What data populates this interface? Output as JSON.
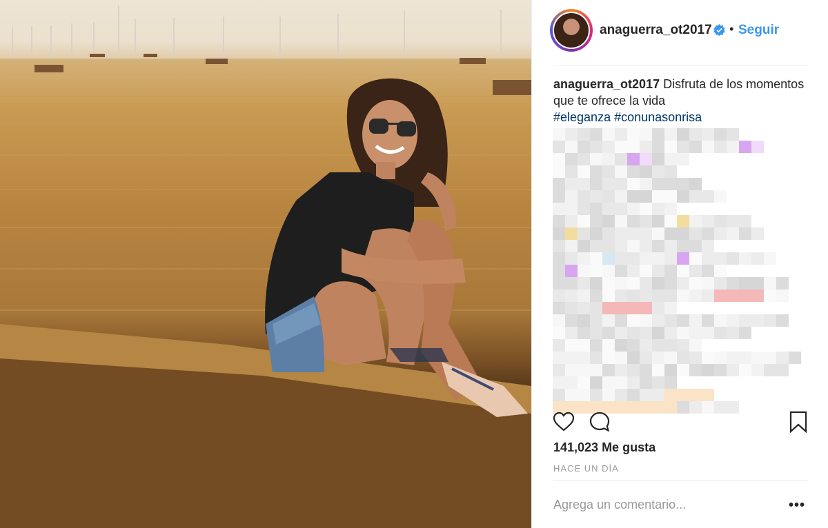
{
  "post": {
    "username": "anaguerra_ot2017",
    "follow_label": "Seguir",
    "separator": "•",
    "caption": {
      "user": "anaguerra_ot2017",
      "text": "Disfruta de los momentos que te ofrece la vida",
      "tags": [
        "#eleganza",
        "#conunasonrisa"
      ]
    },
    "likes_text": "141,023 Me gusta",
    "time_ago": "HACE UN DÍA",
    "comment_placeholder": "Agrega un comentario...",
    "more_label": "•••"
  },
  "icons": {
    "like": "heart-icon",
    "comment": "speech-bubble-icon",
    "save": "bookmark-icon",
    "verified": "verified-badge-icon"
  },
  "colors": {
    "link": "#3897f0",
    "hashtag": "#003569",
    "verified": "#3897f0",
    "muted": "#999999"
  }
}
